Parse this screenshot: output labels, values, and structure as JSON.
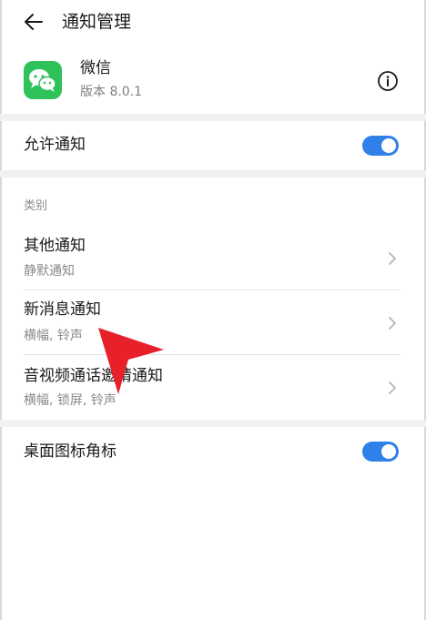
{
  "header": {
    "title": "通知管理",
    "back_icon": "arrow-left-icon"
  },
  "app": {
    "name": "微信",
    "version": "版本 8.0.1",
    "icon": "wechat-icon",
    "brand_color": "#2fc25b",
    "info_icon": "info-icon"
  },
  "allow_notifications": {
    "label": "允许通知",
    "enabled": true
  },
  "categories": {
    "label": "类别",
    "items": [
      {
        "title": "其他通知",
        "subtitle": "静默通知"
      },
      {
        "title": "新消息通知",
        "subtitle": "横幅, 铃声"
      },
      {
        "title": "音视频通话邀请通知",
        "subtitle": "横幅, 锁屏, 铃声"
      }
    ]
  },
  "badge": {
    "label": "桌面图标角标",
    "enabled": true
  },
  "colors": {
    "accent": "#2f80e8",
    "pointer": "#e8202a"
  }
}
